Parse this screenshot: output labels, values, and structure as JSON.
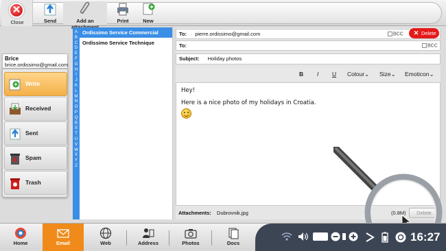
{
  "toolbar": {
    "close_label": "Close",
    "send_label": "Send",
    "attach_label": "Add an attachment",
    "print_label": "Print",
    "new_label": "New"
  },
  "account": {
    "name": "Brice",
    "email": "brice.ordissimo@gmail.com"
  },
  "folders": [
    {
      "label": "Write",
      "icon": "write-icon",
      "active": true
    },
    {
      "label": "Received",
      "icon": "inbox-icon"
    },
    {
      "label": "Sent",
      "icon": "sent-icon"
    },
    {
      "label": "Spam",
      "icon": "spam-icon"
    },
    {
      "label": "Trash",
      "icon": "trash-icon"
    }
  ],
  "alphabet": [
    "A",
    "B",
    "C",
    "D",
    "E",
    "F",
    "G",
    "H",
    "I",
    "J",
    "K",
    "L",
    "M",
    "N",
    "O",
    "P",
    "Q",
    "R",
    "S",
    "T",
    "U",
    "V",
    "W",
    "X",
    "Y",
    "Z"
  ],
  "contacts": [
    "Ordissimo Service Commercial",
    "Ordissimo Service Technique"
  ],
  "compose": {
    "to_label": "To:",
    "to_value": "pierre.ordissimo@gmail.com",
    "to2_label": "To:",
    "to2_value": "",
    "bcc_label": "BCC",
    "delete_label": "Delete",
    "subject_label": "Subject:",
    "subject_value": "Holiday photos",
    "format": {
      "bold": "B",
      "italic": "I",
      "underline": "U",
      "colour": "Colour",
      "size": "Size",
      "emoticon": "Emoticon"
    },
    "body_line1": "Hey!",
    "body_line2": "Here is a nice photo of my holidays in Croatia.",
    "attach_label": "Attachments:",
    "attach_file": "Dubrovnik.jpg",
    "attach_size": "(0.8M)",
    "attach_delete": "Delete"
  },
  "taskbar": {
    "items": [
      {
        "label": "Home",
        "icon": "home-icon"
      },
      {
        "label": "Email",
        "icon": "email-icon",
        "active": true
      },
      {
        "label": "Web",
        "icon": "web-icon"
      },
      {
        "label": "Address",
        "icon": "address-icon"
      },
      {
        "label": "Photos",
        "icon": "photos-icon"
      },
      {
        "label": "Docs",
        "icon": "docs-icon"
      }
    ],
    "time": "16:27"
  },
  "colors": {
    "accent_orange": "#f08a1a",
    "contact_blue": "#3a8ee6",
    "delete_red": "#e51a1a",
    "tray_dark": "#3c4554"
  }
}
